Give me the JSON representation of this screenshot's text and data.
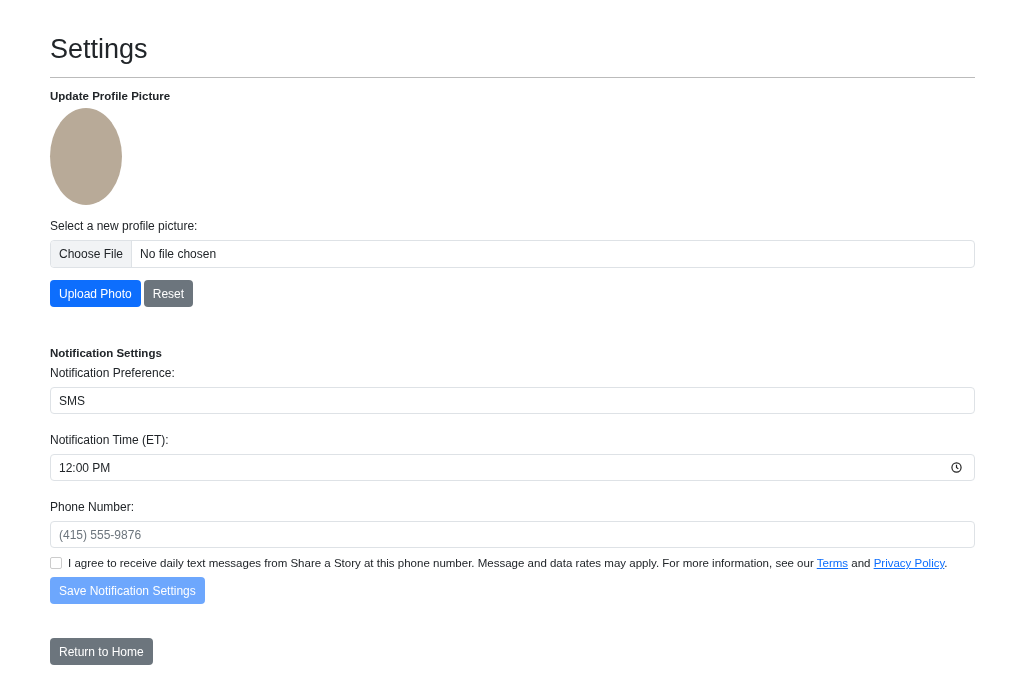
{
  "title": "Settings",
  "profile": {
    "heading": "Update Profile Picture",
    "file_label": "Select a new profile picture:",
    "choose_button": "Choose File",
    "file_status": "No file chosen",
    "upload_button": "Upload Photo",
    "reset_button": "Reset"
  },
  "notifications": {
    "heading": "Notification Settings",
    "preference": {
      "label": "Notification Preference:",
      "value": "SMS"
    },
    "time": {
      "label": "Notification Time (ET):",
      "value": "12:00 PM"
    },
    "phone": {
      "label": "Phone Number:",
      "placeholder": "(415) 555-9876"
    },
    "consent": {
      "checked": false,
      "text": "I agree to receive daily text messages from Share a Story at this phone number. Message and data rates may apply. For more information, see our",
      "terms_link": "Terms",
      "joiner": "and",
      "privacy_link": "Privacy Policy",
      "end": "."
    },
    "save_button": {
      "label": "Save Notification Settings",
      "disabled": true
    }
  },
  "return_button": "Return to Home"
}
